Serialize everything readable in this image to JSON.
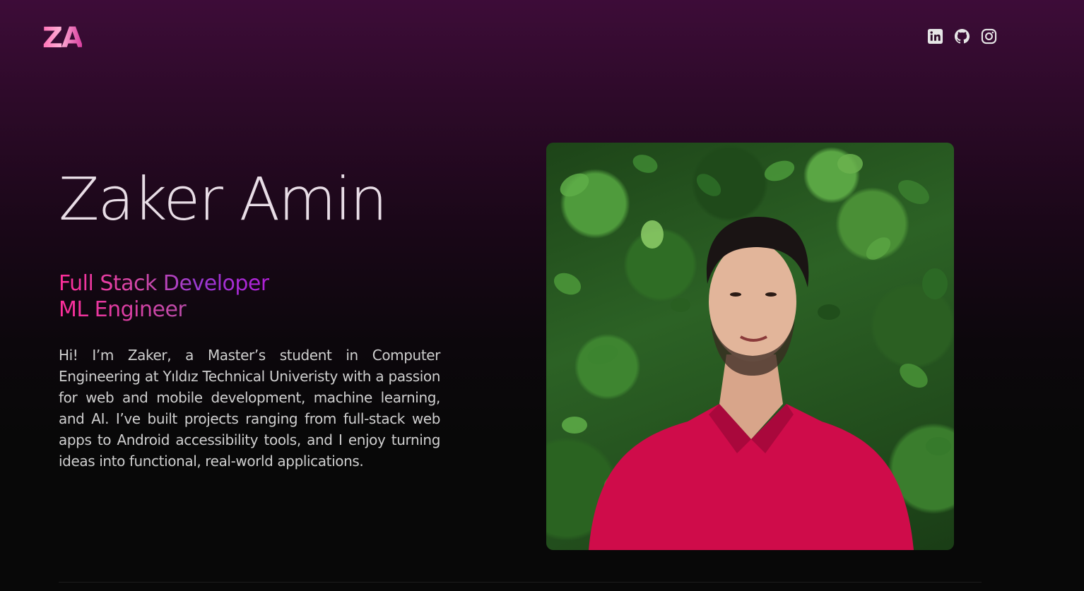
{
  "header": {
    "logo": "ZA",
    "socials": [
      {
        "name": "linkedin",
        "icon": "linkedin-icon"
      },
      {
        "name": "github",
        "icon": "github-icon"
      },
      {
        "name": "instagram",
        "icon": "instagram-icon"
      }
    ]
  },
  "hero": {
    "name": "Zaker Amin",
    "roles": [
      "Full Stack Developer",
      "ML Engineer"
    ],
    "bio": "Hi! I’m Zaker, a Master’s student in Computer Engineering at Yıldız Technical Univeristy with a passion for web and mobile development, machine learning, and AI. I’ve built projects ranging from full-stack web apps to Android accessibility tools, and I enjoy turning ideas into functional, real-world applications."
  },
  "colors": {
    "background_top": "#3d0c38",
    "background_bottom": "#080808",
    "accent_pink": "#ff2d9a",
    "accent_purple": "#b01fd6",
    "text": "#cfcfcf"
  }
}
